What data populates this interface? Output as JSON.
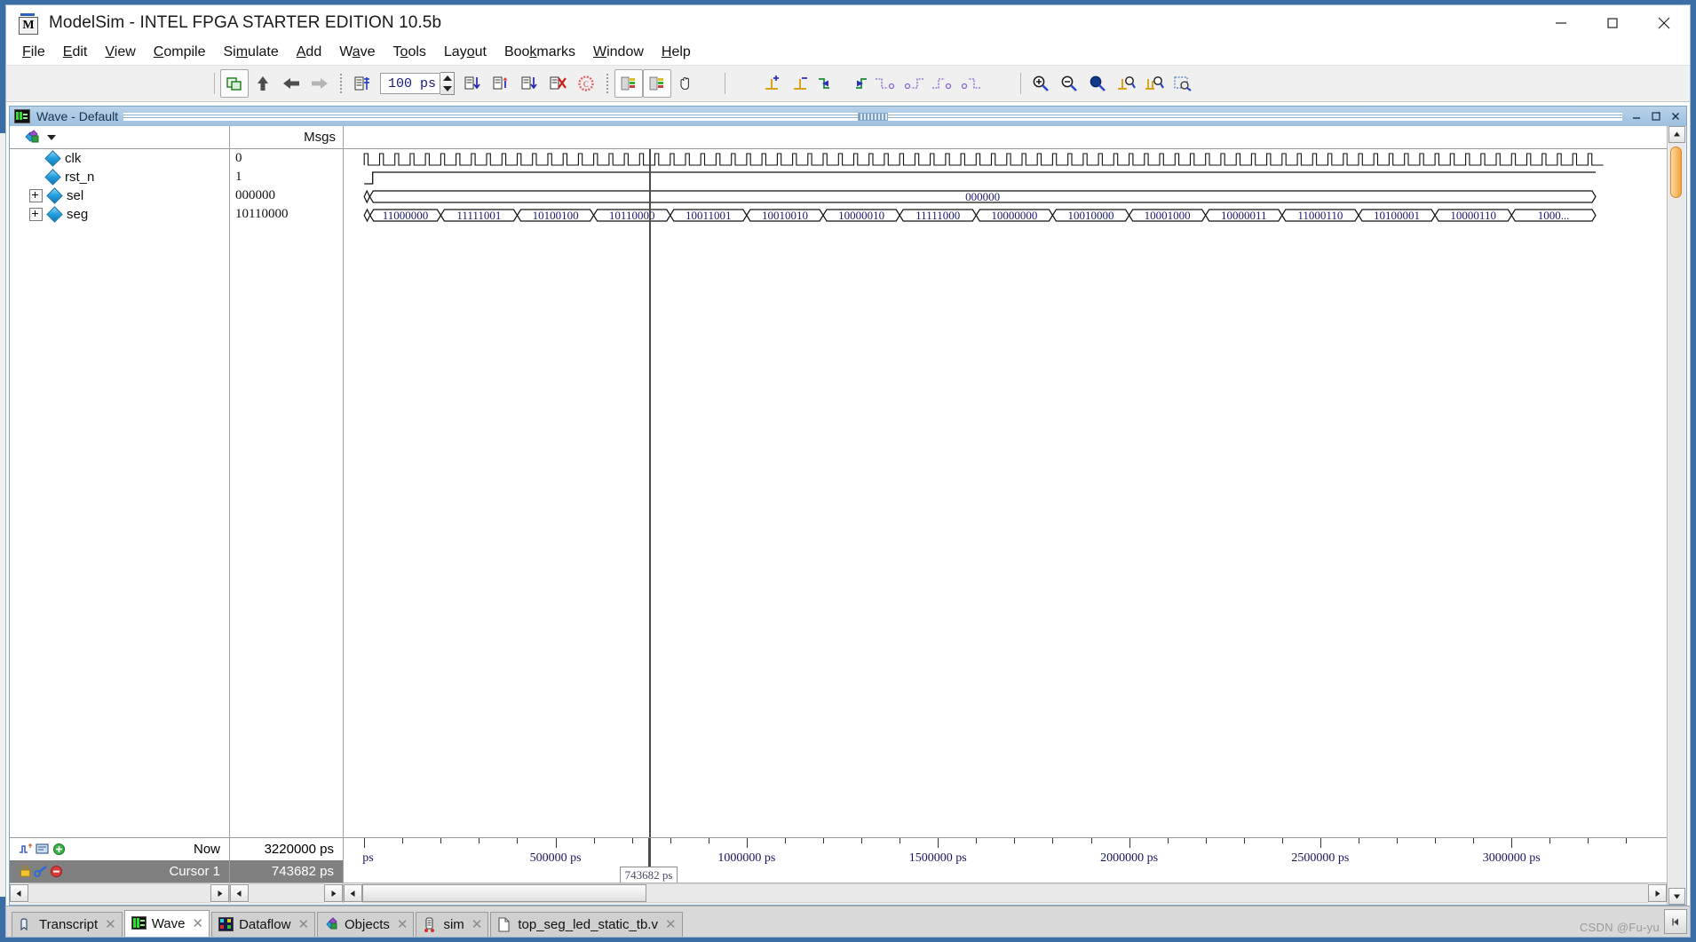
{
  "window": {
    "title": "ModelSim - INTEL FPGA STARTER EDITION 10.5b",
    "app_icon": "modelsim-m-icon",
    "minimize": "—",
    "maximize": "□",
    "close": "✕"
  },
  "menu": [
    {
      "label": "File",
      "accel": "F"
    },
    {
      "label": "Edit",
      "accel": "E"
    },
    {
      "label": "View",
      "accel": "V"
    },
    {
      "label": "Compile",
      "accel": "C"
    },
    {
      "label": "Simulate",
      "accel": "S"
    },
    {
      "label": "Add",
      "accel": "A"
    },
    {
      "label": "Wave",
      "accel": "W"
    },
    {
      "label": "Tools",
      "accel": "T"
    },
    {
      "label": "Layout",
      "accel": "L"
    },
    {
      "label": "Bookmarks",
      "accel": "B"
    },
    {
      "label": "Window",
      "accel": "W"
    },
    {
      "label": "Help",
      "accel": "H"
    }
  ],
  "toolbar": {
    "time_step_value": "100 ps",
    "buttons": [
      "copy-signals-icon",
      "step-up-icon",
      "step-back-icon",
      "step-forward-icon",
      "simulate-list-icon",
      "run-length-icon",
      "run-icon",
      "continue-run-icon",
      "run-all-icon",
      "break-icon",
      "stop-icon",
      "wave-compare-icon",
      "wave-compare-alt-icon",
      "grab-hand-icon",
      "insert-cursor-icon",
      "delete-cursor-icon",
      "find-previous-transition-icon",
      "find-next-transition-icon",
      "find-previous-falling-icon",
      "find-next-falling-icon",
      "find-previous-rising-icon",
      "find-next-rising-icon",
      "zoom-in-icon",
      "zoom-out-icon",
      "zoom-full-icon",
      "zoom-cursor-icon",
      "zoom-range-icon",
      "zoom-mouse-icon"
    ]
  },
  "wave_window": {
    "title": "Wave - Default",
    "icon": "wave-window-icon",
    "minimize": "─",
    "restore": "⬌",
    "close": "✕",
    "names_header_icon": "objects-filter-icon",
    "values_header": "Msgs"
  },
  "signals": [
    {
      "name": "clk",
      "value": "0",
      "expandable": false,
      "type": "wave",
      "icon": "signal-diamond-icon"
    },
    {
      "name": "rst_n",
      "value": "1",
      "expandable": false,
      "type": "wave",
      "icon": "signal-diamond-icon"
    },
    {
      "name": "sel",
      "value": "000000",
      "expandable": true,
      "type": "bus",
      "icon": "signal-diamond-icon"
    },
    {
      "name": "seg",
      "value": "10110000",
      "expandable": true,
      "type": "bus",
      "icon": "signal-diamond-icon"
    }
  ],
  "controls": {
    "now_label": "Now",
    "now_value": "3220000 ps",
    "cursor_label": "Cursor 1",
    "cursor_value": "743682 ps",
    "now_icons": [
      "timeline-icon",
      "now-marker-icon",
      "add-cursor-icon"
    ],
    "cursor_icons": [
      "lock-cursor-icon",
      "configure-cursor-icon",
      "delete-cursor-icon"
    ]
  },
  "chart_data": {
    "type": "waveform",
    "title": "Wave - Default",
    "time_unit": "ps",
    "xlim": [
      0,
      3220000
    ],
    "view_xlim": [
      -40000,
      3220000
    ],
    "cursor_time": 743682,
    "cursor_label": "743682 ps",
    "now_time": 3220000,
    "axis_ticks_major": [
      0,
      500000,
      1000000,
      1500000,
      2000000,
      2500000,
      3000000
    ],
    "axis_tick_labels": [
      "ps",
      "500000 ps",
      "1000000 ps",
      "1500000 ps",
      "2000000 ps",
      "2500000 ps",
      "3000000 ps"
    ],
    "minor_ticks_per_major": 5,
    "signals": [
      {
        "name": "clk",
        "kind": "clock",
        "period_ps": 40000,
        "duty": 0.25,
        "start_low": true
      },
      {
        "name": "rst_n",
        "kind": "digital",
        "transitions": [
          {
            "t": 0,
            "v": 0
          },
          {
            "t": 22000,
            "v": 1
          }
        ]
      },
      {
        "name": "sel",
        "kind": "bus",
        "segments": [
          {
            "t_start": 0,
            "t_end": 14000,
            "value": ""
          },
          {
            "t_start": 14000,
            "t_end": 3220000,
            "value": "000000"
          }
        ]
      },
      {
        "name": "seg",
        "kind": "bus",
        "segments": [
          {
            "t_start": 0,
            "t_end": 15000,
            "value": ""
          },
          {
            "t_start": 15000,
            "t_end": 200000,
            "value": "11000000"
          },
          {
            "t_start": 200000,
            "t_end": 400000,
            "value": "11111001"
          },
          {
            "t_start": 400000,
            "t_end": 600000,
            "value": "10100100"
          },
          {
            "t_start": 600000,
            "t_end": 800000,
            "value": "10110000"
          },
          {
            "t_start": 800000,
            "t_end": 1000000,
            "value": "10011001"
          },
          {
            "t_start": 1000000,
            "t_end": 1200000,
            "value": "10010010"
          },
          {
            "t_start": 1200000,
            "t_end": 1400000,
            "value": "10000010"
          },
          {
            "t_start": 1400000,
            "t_end": 1600000,
            "value": "11111000"
          },
          {
            "t_start": 1600000,
            "t_end": 1800000,
            "value": "10000000"
          },
          {
            "t_start": 1800000,
            "t_end": 2000000,
            "value": "10010000"
          },
          {
            "t_start": 2000000,
            "t_end": 2200000,
            "value": "10001000"
          },
          {
            "t_start": 2200000,
            "t_end": 2400000,
            "value": "10000011"
          },
          {
            "t_start": 2400000,
            "t_end": 2600000,
            "value": "11000110"
          },
          {
            "t_start": 2600000,
            "t_end": 2800000,
            "value": "10100001"
          },
          {
            "t_start": 2800000,
            "t_end": 3000000,
            "value": "10000110"
          },
          {
            "t_start": 3000000,
            "t_end": 3220000,
            "value": "1000..."
          }
        ]
      }
    ]
  },
  "tabs": [
    {
      "label": "Transcript",
      "icon": "transcript-icon",
      "active": false,
      "close": "✕"
    },
    {
      "label": "Wave",
      "icon": "wave-tab-icon",
      "active": true,
      "close": "✕"
    },
    {
      "label": "Dataflow",
      "icon": "dataflow-icon",
      "active": false,
      "close": "✕"
    },
    {
      "label": "Objects",
      "icon": "objects-icon",
      "active": false,
      "close": "✕"
    },
    {
      "label": "sim",
      "icon": "sim-icon",
      "active": false,
      "close": "✕"
    },
    {
      "label": "top_seg_led_static_tb.v",
      "icon": "file-icon",
      "active": false,
      "close": "✕"
    }
  ],
  "watermark": "CSDN @Fu-yu",
  "colors": {
    "wave_line": "#101010",
    "bus_text": "#1a1a6e",
    "cursor": "#4c4c4c",
    "titlebar_gradient_top": "#b9d2ea",
    "titlebar_gradient_bottom": "#9dc0de",
    "selected_row": "#808080",
    "scrollbar_thumb": "#f5a23c"
  }
}
